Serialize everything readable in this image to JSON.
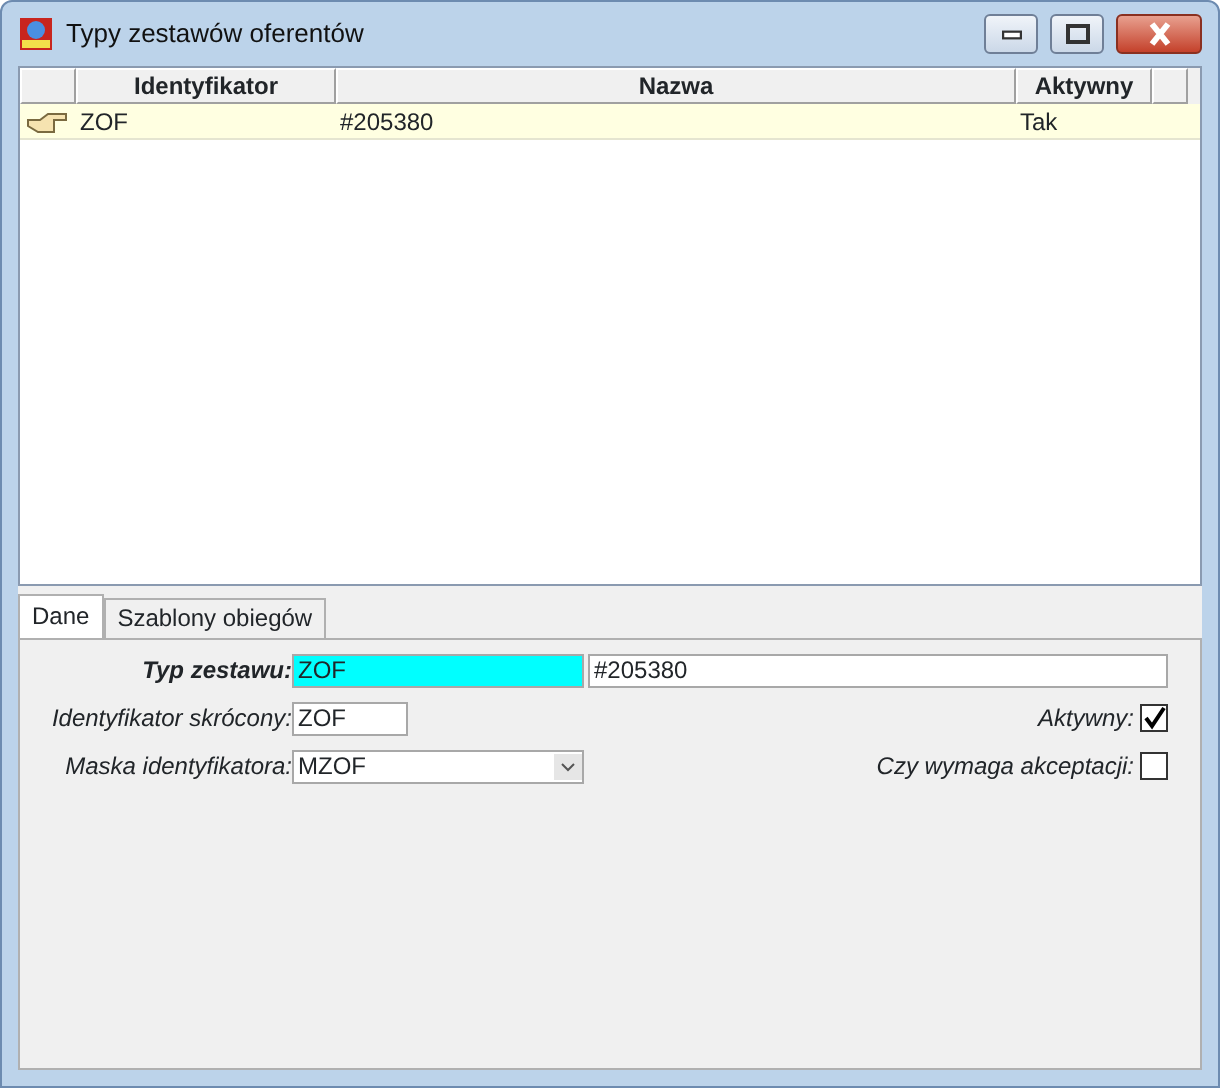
{
  "window": {
    "title": "Typy zestawów oferentów"
  },
  "table": {
    "columns": [
      "Identyfikator",
      "Nazwa",
      "Aktywny"
    ],
    "rows": [
      {
        "cells": [
          "ZOF",
          "#205380",
          "Tak"
        ],
        "selected": true
      }
    ]
  },
  "tabs": [
    {
      "label": "Dane",
      "selected": true
    },
    {
      "label": "Szablony obiegów",
      "selected": false
    }
  ],
  "form": {
    "typ_label": "Typ zestawu:",
    "typ_value": "ZOF",
    "typ_name": "#205380",
    "short_label": "Identyfikator skrócony:",
    "short_value": "ZOF",
    "mask_label": "Maska identyfikatora:",
    "mask_value": "MZOF",
    "checks": [
      {
        "label": "Aktywny:",
        "checked": true
      },
      {
        "label": "Czy wymaga akceptacji:",
        "checked": false
      }
    ]
  }
}
